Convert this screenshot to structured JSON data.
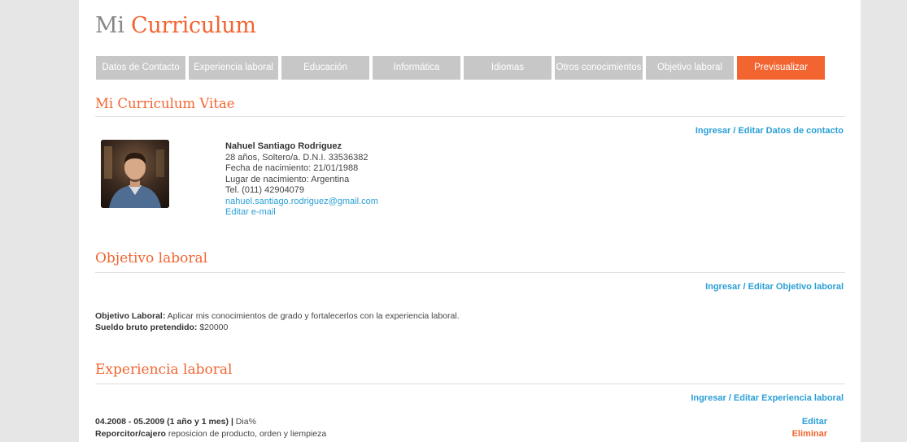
{
  "header": {
    "title_part1": "Mi",
    "title_part2": "Curriculum"
  },
  "tabs": [
    {
      "label": "Datos de Contacto",
      "active": false
    },
    {
      "label": "Experiencia laboral",
      "active": false
    },
    {
      "label": "Educación",
      "active": false
    },
    {
      "label": "Informática",
      "active": false
    },
    {
      "label": "Idiomas",
      "active": false
    },
    {
      "label": "Otros conocimientos",
      "active": false
    },
    {
      "label": "Objetivo laboral",
      "active": false
    },
    {
      "label": "Previsualizar",
      "active": true
    }
  ],
  "colors": {
    "accent": "#f26531",
    "link": "#2a9fd6",
    "tab_inactive": "#c7c7c7"
  },
  "cv": {
    "title": "Mi Curriculum Vitae",
    "edit_contact_link": "Ingresar / Editar Datos de contacto"
  },
  "contact": {
    "name": "Nahuel Santiago Rodriguez",
    "age_status_dni": "28 años, Soltero/a. D.N.I. 33536382",
    "birth_date": "Fecha de nacimiento: 21/01/1988",
    "birth_place": "Lugar de nacimiento: Argentina",
    "phone": "Tel. (011) 42904079",
    "email": "nahuel.santiago.rodriguez@gmail.com",
    "edit_email": "Editar e-mail"
  },
  "objective": {
    "title": "Objetivo laboral",
    "edit_link": "Ingresar / Editar Objetivo laboral",
    "objective_label": "Objetivo Laboral:",
    "objective_text": " Aplicar mis conocimientos de grado y fortalecerlos con la experiencia laboral.",
    "salary_label": "Sueldo bruto pretendido:",
    "salary_text": " $20000"
  },
  "experience": {
    "title": "Experiencia laboral",
    "edit_link": "Ingresar / Editar Experiencia laboral",
    "items": [
      {
        "period": "04.2008 - 05.2009 (1 año y 1 mes) |",
        "company": "  Dia%",
        "role": "Reporcitor/cajero",
        "description": " reposicion de producto, orden y liempieza",
        "edit_label": "Editar",
        "delete_label": "Eliminar"
      }
    ]
  }
}
